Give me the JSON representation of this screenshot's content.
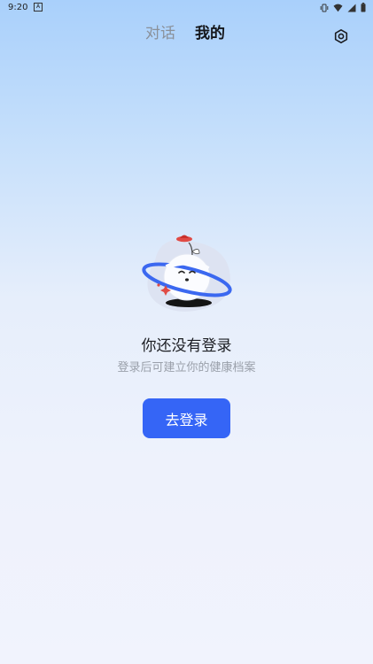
{
  "status_bar": {
    "time": "9:20",
    "notification_icon": "a-notification-icon",
    "icons": [
      "vibrate-icon",
      "wifi-icon",
      "signal-icon",
      "battery-icon"
    ]
  },
  "header": {
    "tabs": [
      {
        "label": "对话",
        "active": false
      },
      {
        "label": "我的",
        "active": true
      }
    ],
    "settings_icon": "gear-icon"
  },
  "empty_state": {
    "illustration": "planet-mascot-illustration",
    "title": "你还没有登录",
    "subtitle": "登录后可建立你的健康档案",
    "button_label": "去登录"
  },
  "colors": {
    "accent": "#3565f6",
    "gradient_top": "#a9d0fb",
    "gradient_bottom": "#f1f3fd"
  }
}
